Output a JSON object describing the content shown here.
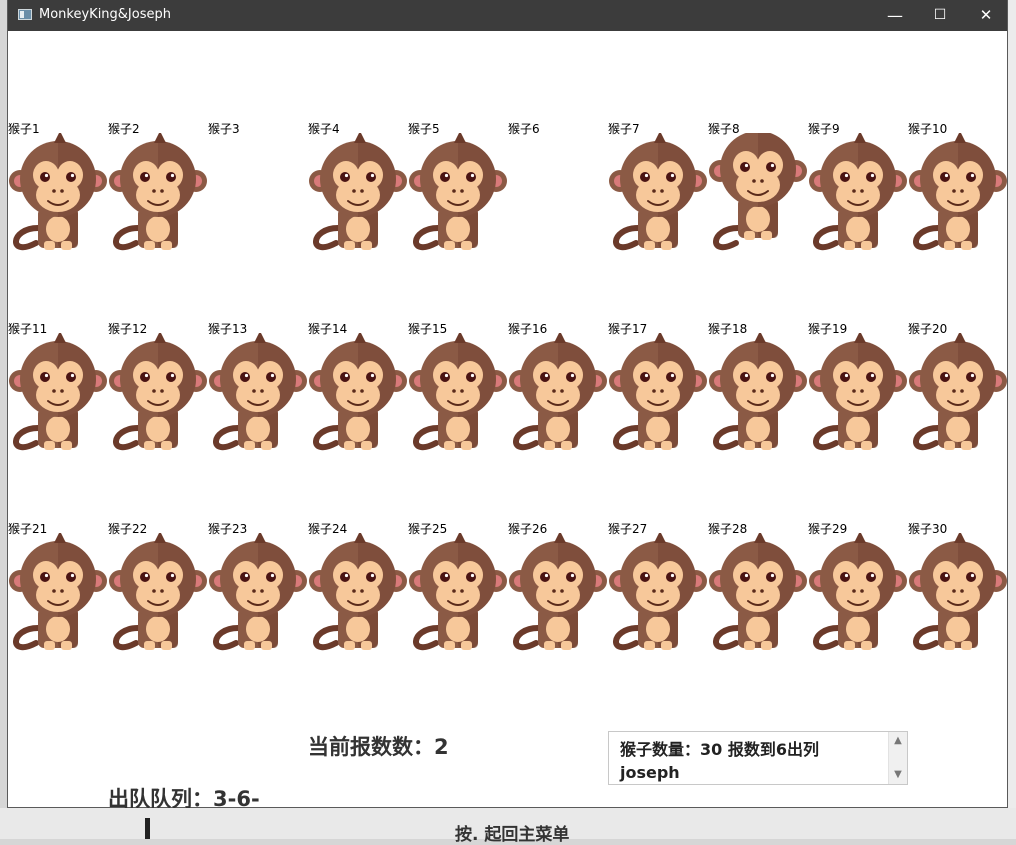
{
  "window": {
    "title": "MonkeyKing&Joseph",
    "icon": "app-window-icon"
  },
  "title_buttons": {
    "minimize": "—",
    "maximize": "☐",
    "close": "✕"
  },
  "monkeys": {
    "rows": [
      [
        {
          "label": "猴子1",
          "visible": true
        },
        {
          "label": "猴子2",
          "visible": true
        },
        {
          "label": "猴子3",
          "visible": false
        },
        {
          "label": "猴子4",
          "visible": true
        },
        {
          "label": "猴子5",
          "visible": true
        },
        {
          "label": "猴子6",
          "visible": false
        },
        {
          "label": "猴子7",
          "visible": true
        },
        {
          "label": "猴子8",
          "visible": true,
          "pose": "alternate"
        },
        {
          "label": "猴子9",
          "visible": true
        },
        {
          "label": "猴子10",
          "visible": true
        }
      ],
      [
        {
          "label": "猴子11",
          "visible": true
        },
        {
          "label": "猴子12",
          "visible": true
        },
        {
          "label": "猴子13",
          "visible": true
        },
        {
          "label": "猴子14",
          "visible": true
        },
        {
          "label": "猴子15",
          "visible": true
        },
        {
          "label": "猴子16",
          "visible": true
        },
        {
          "label": "猴子17",
          "visible": true
        },
        {
          "label": "猴子18",
          "visible": true
        },
        {
          "label": "猴子19",
          "visible": true
        },
        {
          "label": "猴子20",
          "visible": true
        }
      ],
      [
        {
          "label": "猴子21",
          "visible": true
        },
        {
          "label": "猴子22",
          "visible": true
        },
        {
          "label": "猴子23",
          "visible": true
        },
        {
          "label": "猴子24",
          "visible": true
        },
        {
          "label": "猴子25",
          "visible": true
        },
        {
          "label": "猴子26",
          "visible": true
        },
        {
          "label": "猴子27",
          "visible": true
        },
        {
          "label": "猴子28",
          "visible": true
        },
        {
          "label": "猴子29",
          "visible": true
        },
        {
          "label": "猴子30",
          "visible": true
        }
      ]
    ]
  },
  "status": {
    "current_count": "当前报数数：2",
    "out_queue": "出队队列：3-6-"
  },
  "info_box": {
    "text": "猴子数量：30  报数到6出列\njoseph",
    "scroll_up": "▲",
    "scroll_down": "▼"
  },
  "background_peek_text": "按. 起回主菜单",
  "colors": {
    "titlebar": "#3c3c3c",
    "monkey_fur_light": "#8b5a45",
    "monkey_fur_dark": "#6b3a2a",
    "monkey_face": "#f7c89a",
    "monkey_ear_inner": "#d97a7a"
  }
}
